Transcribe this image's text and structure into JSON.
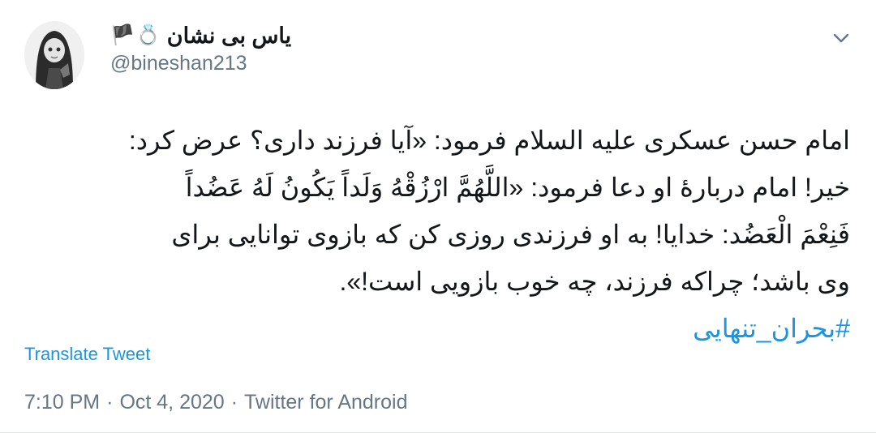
{
  "author": {
    "display_name": "یاس بی نشان",
    "emoji_ring": "💍",
    "emoji_flag": "🏴",
    "handle": "@bineshan213"
  },
  "menu": {
    "icon": "chevron-down-icon"
  },
  "tweet": {
    "lines": [
      "امام حسن عسکری علیه السلام فرمود: «آیا فرزند داری؟ عرض کرد:",
      "خیر! امام دربارهٔ او دعا فرمود: «اللَّهُمَّ ارْزُقْهُ وَلَداً یَکُونُ لَهُ عَضُداً",
      "فَنِعْمَ الْعَضُد:  خدایا! به او فرزندی روزی کن که بازوی توانایی برای",
      "وی باشد؛ چراکه فرزند، چه خوب بازویی است!».",
      ""
    ],
    "hashtag": "#بحران_تنهایی"
  },
  "translate_label": "Translate Tweet",
  "meta": {
    "time": "7:10 PM",
    "separator": "·",
    "date": "Oct 4, 2020",
    "source": "Twitter for Android"
  },
  "colors": {
    "link": "#1b95e0",
    "secondary_text": "#657786",
    "primary_text": "#14171a"
  }
}
